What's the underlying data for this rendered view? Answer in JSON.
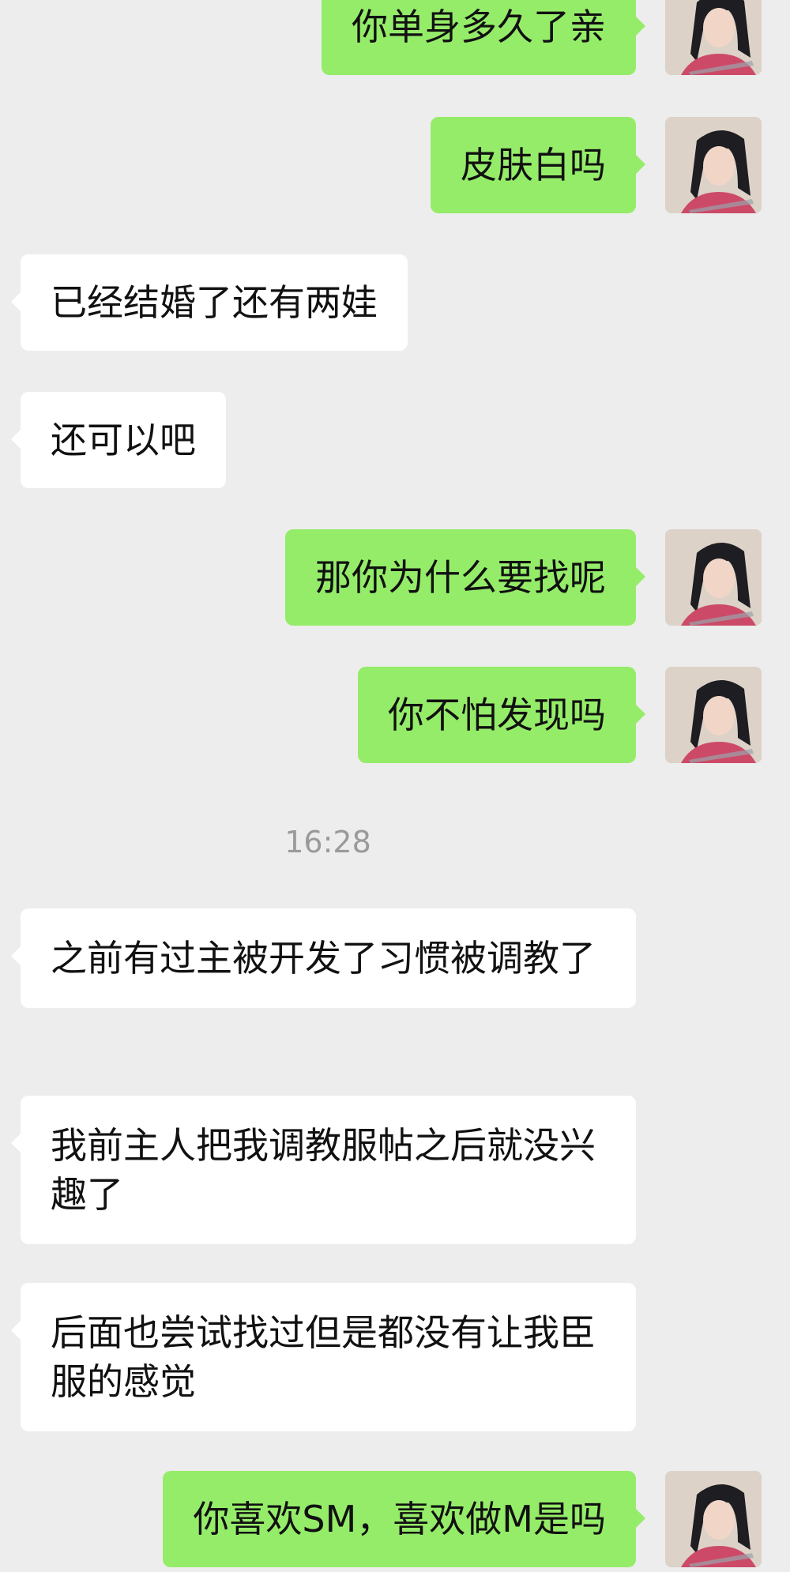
{
  "messages": [
    {
      "side": "sent",
      "text": "你单身多久了亲"
    },
    {
      "side": "sent",
      "text": "皮肤白吗"
    },
    {
      "side": "recv",
      "text": "已经结婚了还有两娃"
    },
    {
      "side": "recv",
      "text": "还可以吧"
    },
    {
      "side": "sent",
      "text": "那你为什么要找呢"
    },
    {
      "side": "sent",
      "text": "你不怕发现吗"
    },
    {
      "timestamp": "16:28"
    },
    {
      "side": "recv",
      "text": "之前有过主被开发了习惯被调教了"
    },
    {
      "side": "recv",
      "text": "我前主人把我调教服帖之后就没兴趣了"
    },
    {
      "side": "recv",
      "text": "后面也尝试找过但是都没有让我臣服的感觉"
    },
    {
      "side": "sent",
      "text": "你喜欢SM，喜欢做M是吗"
    }
  ],
  "colors": {
    "sent_bubble": "#95ec69",
    "recv_bubble": "#ffffff",
    "background": "#ededed",
    "timestamp": "#9a9a9a"
  },
  "icons": {
    "avatar": "user-avatar-photo"
  }
}
